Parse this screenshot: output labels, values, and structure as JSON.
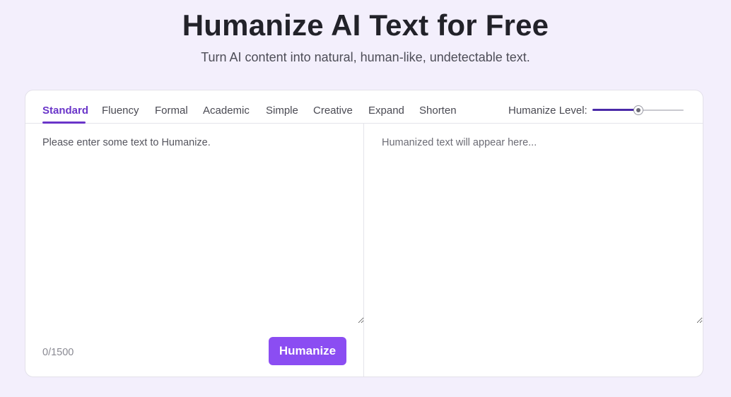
{
  "header": {
    "title": "Humanize AI Text for Free",
    "subtitle": "Turn AI content into natural, human-like, undetectable text."
  },
  "tabs": [
    {
      "label": "Standard",
      "active": true
    },
    {
      "label": "Fluency",
      "active": false
    },
    {
      "label": "Formal",
      "active": false
    },
    {
      "label": "Academic",
      "active": false
    },
    {
      "label": "Simple",
      "active": false
    },
    {
      "label": "Creative",
      "active": false
    },
    {
      "label": "Expand",
      "active": false
    },
    {
      "label": "Shorten",
      "active": false
    }
  ],
  "humanize_level": {
    "label": "Humanize Level:",
    "value_fraction": 0.5
  },
  "input": {
    "value": "",
    "placeholder": "Please enter some text to Humanize.",
    "counter": "0/1500"
  },
  "output": {
    "value": "",
    "placeholder": "Humanized text will appear here..."
  },
  "actions": {
    "humanize_label": "Humanize"
  },
  "colors": {
    "accent": "#6a35c9",
    "button": "#8b4df2",
    "slider_fill": "#4a2aa8",
    "background": "#f3effc"
  }
}
